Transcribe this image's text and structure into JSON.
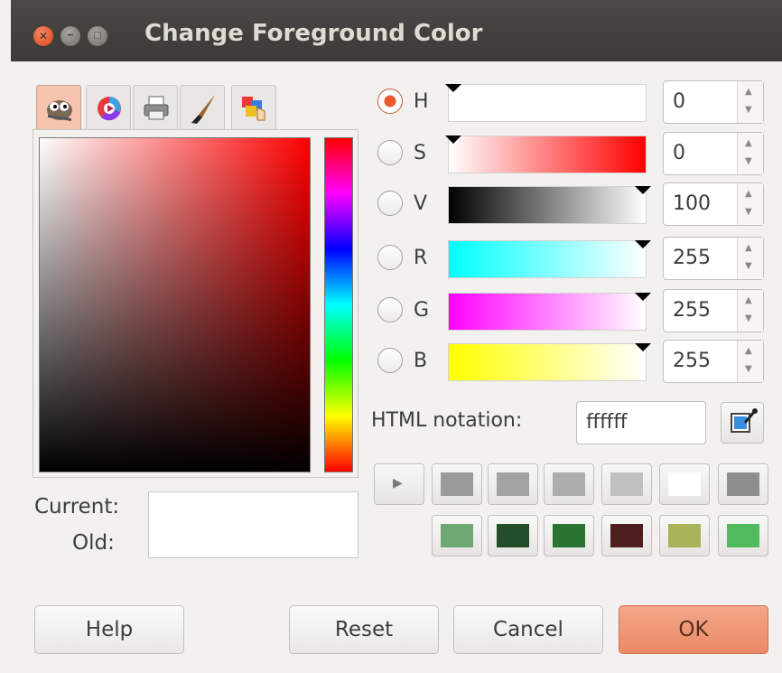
{
  "window": {
    "title": "Change Foreground Color"
  },
  "tabs": [
    {
      "name": "gimp-selector-icon",
      "active": true
    },
    {
      "name": "color-wheel-icon",
      "active": false
    },
    {
      "name": "printer-cmyk-icon",
      "active": false
    },
    {
      "name": "paintbrush-icon",
      "active": false
    },
    {
      "name": "palette-icon",
      "active": false
    }
  ],
  "swatches": {
    "current_label": "Current:",
    "old_label": "Old:",
    "current_color": "#ffffff",
    "old_color": "#ffffff"
  },
  "channels": [
    {
      "label": "H",
      "value": "0",
      "selected": true
    },
    {
      "label": "S",
      "value": "0",
      "selected": false
    },
    {
      "label": "V",
      "value": "100",
      "selected": false
    },
    {
      "label": "R",
      "value": "255",
      "selected": false
    },
    {
      "label": "G",
      "value": "255",
      "selected": false
    },
    {
      "label": "B",
      "value": "255",
      "selected": false
    }
  ],
  "html_notation": {
    "label": "HTML notation:",
    "value": "ffffff"
  },
  "history": {
    "row1": [
      "#9a9a9a",
      "#a3a3a3",
      "#adadad",
      "#c0c0c0",
      "#ffffff",
      "#8e8e8e"
    ],
    "row2": [
      "#6fa874",
      "#244d2a",
      "#2a7330",
      "#4e1f1f",
      "#a8b35a",
      "#4fbb5c"
    ]
  },
  "buttons": {
    "help": "Help",
    "reset": "Reset",
    "cancel": "Cancel",
    "ok": "OK"
  }
}
